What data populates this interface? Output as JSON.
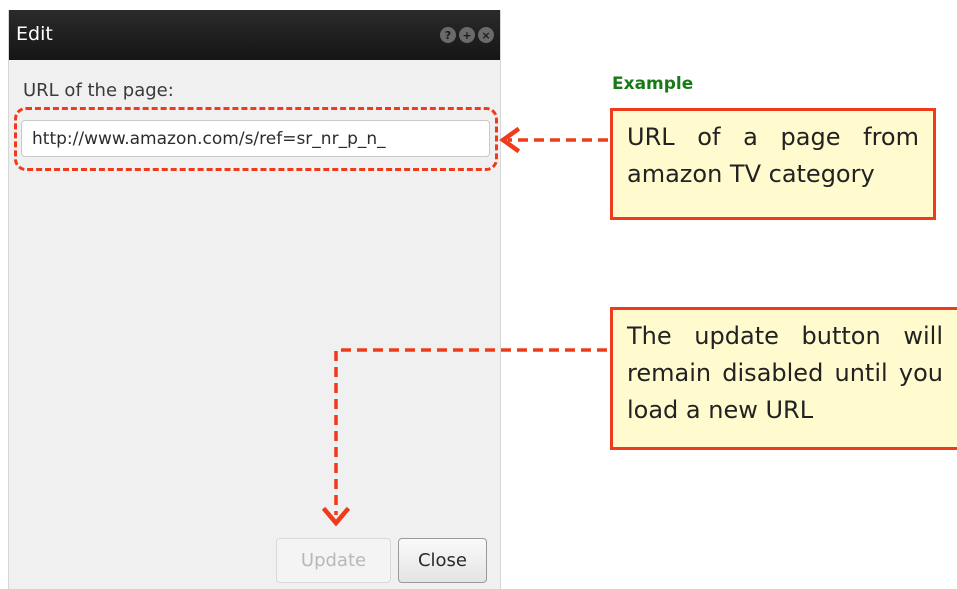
{
  "dialog": {
    "title": "Edit",
    "title_buttons": {
      "help": "?",
      "maximize": "+",
      "close": "×"
    },
    "url_label": "URL of the page:",
    "url_value": "http://www.amazon.com/s/ref=sr_nr_p_n_",
    "update_button": "Update",
    "close_button": "Close"
  },
  "annotations": {
    "example_label": "Example",
    "url_note": "URL of a page from amazon TV category",
    "update_note": "The update button will remain disabled until you load a new URL"
  },
  "colors": {
    "annotation_red": "#ef3b1b",
    "note_background": "#fffbce",
    "example_green": "#177a17",
    "titlebar": "#1c1c1c"
  }
}
